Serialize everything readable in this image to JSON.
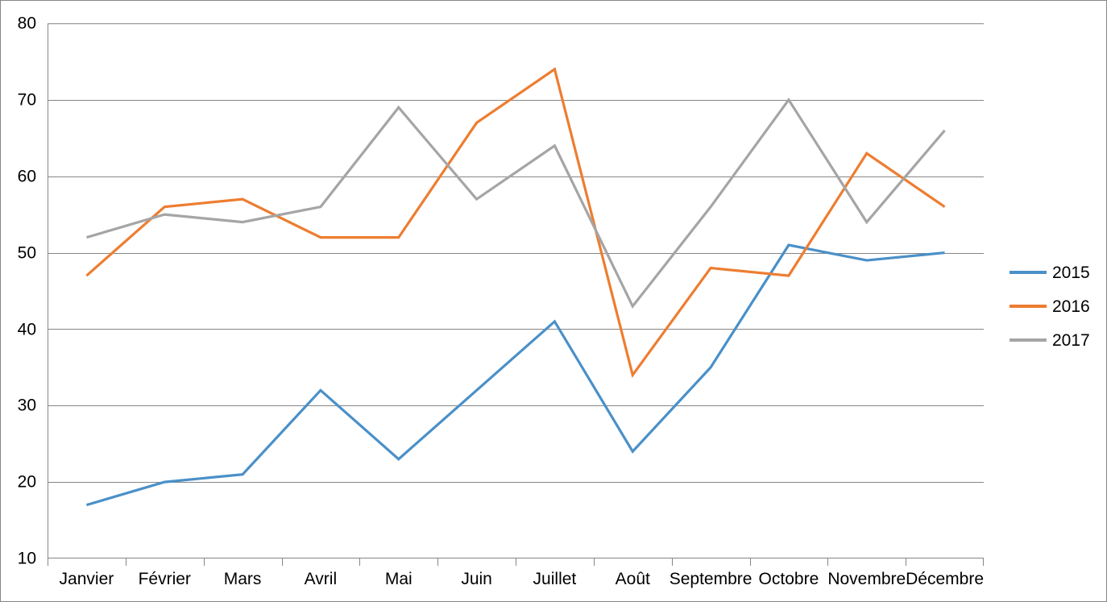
{
  "chart_data": {
    "type": "line",
    "title": "",
    "xlabel": "",
    "ylabel": "",
    "categories": [
      "Janvier",
      "Février",
      "Mars",
      "Avril",
      "Mai",
      "Juin",
      "Juillet",
      "Août",
      "Septembre",
      "Octobre",
      "Novembre",
      "Décembre"
    ],
    "series": [
      {
        "name": "2015",
        "color": "#4A90C8",
        "values": [
          17,
          20,
          21,
          32,
          23,
          32,
          41,
          24,
          35,
          51,
          49,
          50
        ]
      },
      {
        "name": "2016",
        "color": "#ED7D31",
        "values": [
          47,
          56,
          57,
          52,
          52,
          67,
          74,
          34,
          48,
          47,
          63,
          56
        ]
      },
      {
        "name": "2017",
        "color": "#A5A5A5",
        "values": [
          52,
          55,
          54,
          56,
          69,
          57,
          64,
          43,
          56,
          70,
          54,
          66
        ]
      }
    ],
    "ylim": [
      10,
      80
    ],
    "y_ticks": [
      10,
      20,
      30,
      40,
      50,
      60,
      70,
      80
    ],
    "y_tick_labels": [
      "10",
      "20",
      "30",
      "40",
      "50",
      "60",
      "70",
      "80"
    ],
    "grid": true,
    "legend_position": "right",
    "legend_entries": [
      "2015",
      "2016",
      "2017"
    ]
  },
  "axes": {
    "y_labels": [
      "80",
      "70",
      "60",
      "50",
      "40",
      "30",
      "20",
      "10"
    ],
    "x_labels": [
      "Janvier",
      "Février",
      "Mars",
      "Avril",
      "Mai",
      "Juin",
      "Juillet",
      "Août",
      "Septembre",
      "Octobre",
      "Novembre",
      "Décembre"
    ]
  },
  "legend": {
    "items": [
      {
        "label": "2015"
      },
      {
        "label": "2016"
      },
      {
        "label": "2017"
      }
    ]
  },
  "colors": {
    "series_2015": "#4A90C8",
    "series_2016": "#ED7D31",
    "series_2017": "#A5A5A5",
    "gridline": "#868686",
    "border": "#868686",
    "background": "#FFFFFF",
    "text": "#000000"
  }
}
